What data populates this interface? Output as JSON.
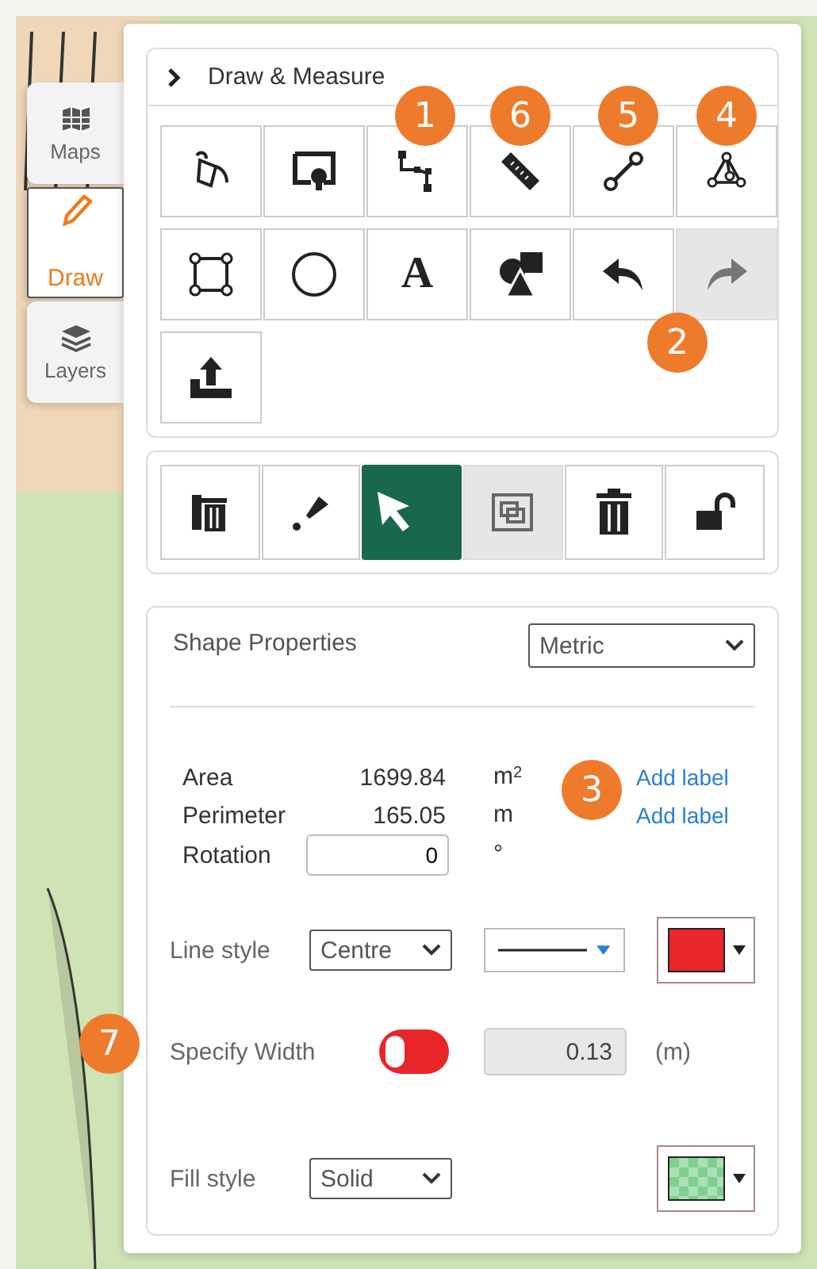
{
  "side_tabs": [
    {
      "label": "Maps",
      "selected": false
    },
    {
      "label": "Draw",
      "selected": true
    },
    {
      "label": "Layers",
      "selected": false
    }
  ],
  "draw_panel": {
    "title": "Draw & Measure",
    "tools": [
      {
        "kind": "icon",
        "disabled": false
      },
      {
        "kind": "icon",
        "disabled": false
      },
      {
        "kind": "icon",
        "disabled": false
      },
      {
        "kind": "icon",
        "disabled": false
      },
      {
        "kind": "icon",
        "disabled": false
      },
      {
        "kind": "icon",
        "disabled": false
      },
      {
        "kind": "icon",
        "disabled": false
      },
      {
        "kind": "icon",
        "disabled": false
      },
      {
        "kind": "glyph",
        "text": "A",
        "disabled": false
      },
      {
        "kind": "icon",
        "disabled": false
      },
      {
        "kind": "icon",
        "disabled": false
      },
      {
        "kind": "icon",
        "disabled": true
      },
      {
        "kind": "icon",
        "disabled": false
      }
    ]
  },
  "edit_tools": [
    {
      "selected": false,
      "disabled": false
    },
    {
      "selected": false,
      "disabled": false
    },
    {
      "selected": true,
      "disabled": false
    },
    {
      "selected": false,
      "disabled": true
    },
    {
      "selected": false,
      "disabled": false
    },
    {
      "selected": false,
      "disabled": false
    }
  ],
  "shape_properties": {
    "title": "Shape Properties",
    "units": "Metric",
    "measurements": [
      {
        "label": "Area",
        "value": "1699.84",
        "unit": "m$^{2}$",
        "link": "Add label"
      },
      {
        "label": "Perimeter",
        "value": "165.05",
        "unit": "m",
        "link": "Add label"
      }
    ],
    "rotation": {
      "label": "Rotation",
      "value": "0",
      "unit": "°"
    },
    "line_style": {
      "label": "Line style",
      "position": "Centre",
      "color": "#e8262a"
    },
    "specify_width": {
      "label": "Specify Width",
      "on": false,
      "value": "0.13",
      "unit": "(m)"
    },
    "fill_style": {
      "label": "Fill style",
      "style": "Solid",
      "color": "#7fd08f"
    }
  },
  "callouts": [
    "1",
    "6",
    "5",
    "4",
    "2",
    "3",
    "7"
  ]
}
